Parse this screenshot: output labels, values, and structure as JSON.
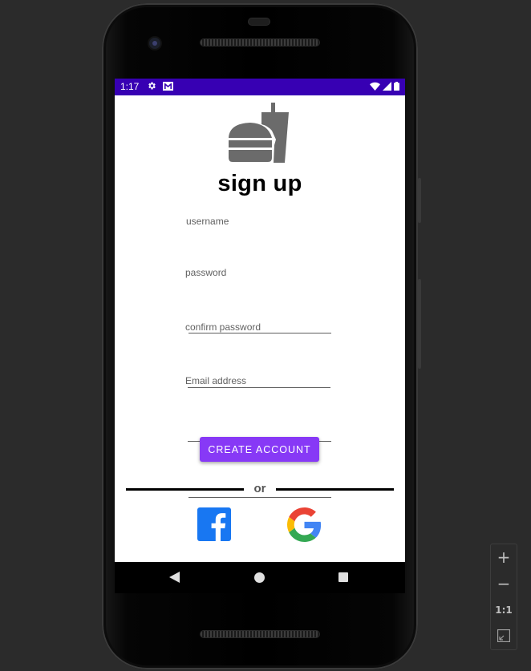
{
  "status_bar": {
    "time": "1:17",
    "background": "#3700b3",
    "icons": [
      "settings-icon",
      "mail-icon",
      "wifi-icon",
      "signal-icon",
      "battery-icon"
    ]
  },
  "app": {
    "logo_icon": "burger-and-drink-icon",
    "title": "sign up",
    "fields": [
      {
        "label": "username",
        "value": ""
      },
      {
        "label": "password",
        "value": ""
      },
      {
        "label": "confirm password",
        "value": ""
      },
      {
        "label": "Email address",
        "value": ""
      }
    ],
    "create_button_label": "CREATE ACCOUNT",
    "accent_color": "#8739f6",
    "divider_text": "or",
    "social": [
      "facebook-icon",
      "google-icon"
    ]
  },
  "nav_bar": {
    "icons": [
      "back-icon",
      "home-icon",
      "recents-icon"
    ]
  },
  "emulator_zoom": {
    "zoom_in_label": "+",
    "zoom_out_label": "−",
    "actual_size_label": "1:1",
    "fit_screen_icon": "fit-screen-icon"
  }
}
